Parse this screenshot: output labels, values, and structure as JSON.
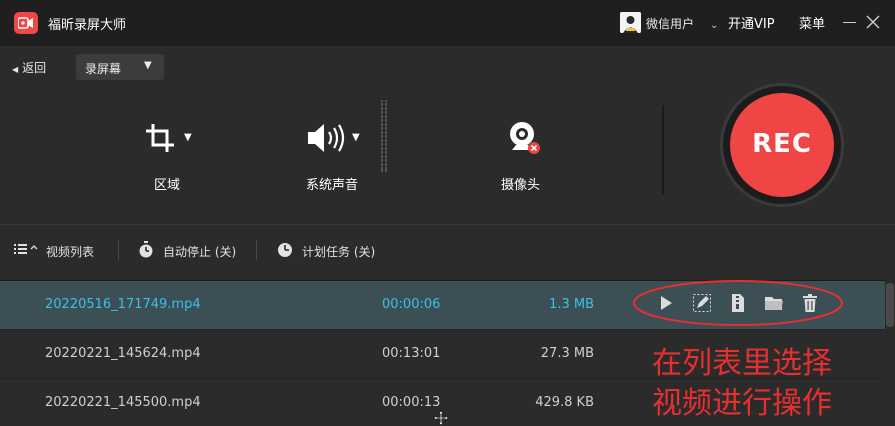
{
  "app": {
    "name": "福昕录屏大师"
  },
  "titlebar": {
    "user_name": "微信用户",
    "vip_label": "开通VIP",
    "menu_label": "菜单"
  },
  "mode_row": {
    "back_label": "返回",
    "mode_value": "录屏幕"
  },
  "controls": {
    "region_label": "区域",
    "audio_label": "系统声音",
    "camera_label": "摄像头",
    "rec_label": "REC"
  },
  "toolbar": {
    "video_list_label": "视频列表",
    "auto_stop_label": "自动停止 (关)",
    "schedule_label": "计划任务 (关)"
  },
  "file_list": {
    "rows": [
      {
        "name": "20220516_171749.mp4",
        "duration": "00:00:06",
        "size": "1.3 MB",
        "selected": true
      },
      {
        "name": "20220221_145624.mp4",
        "duration": "00:13:01",
        "size": "27.3 MB",
        "selected": false
      },
      {
        "name": "20220221_145500.mp4",
        "duration": "00:00:13",
        "size": "429.8 KB",
        "selected": false
      }
    ],
    "row_actions": [
      "play-icon",
      "edit-icon",
      "compress-icon",
      "folder-icon",
      "delete-icon"
    ]
  },
  "annotation": {
    "line1": "在列表里选择",
    "line2": "视频进行操作",
    "color": "#e63030"
  },
  "colors": {
    "accent_cyan": "#3cc0e6",
    "rec_red": "#ef4545",
    "selected_row": "#3b4f55"
  }
}
